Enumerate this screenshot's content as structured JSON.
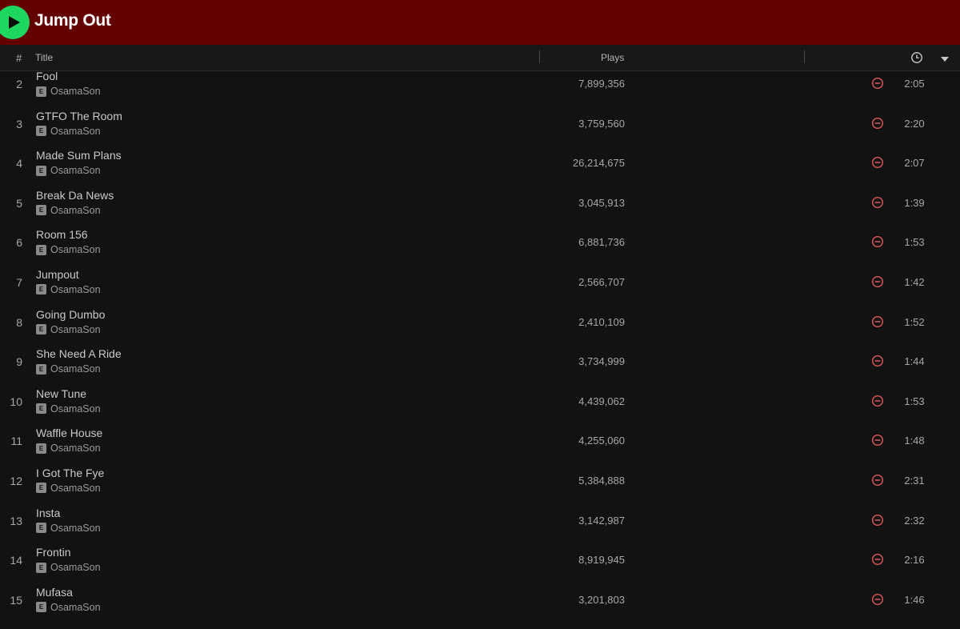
{
  "header": {
    "album_title": "Jump Out"
  },
  "columns": {
    "number": "#",
    "title": "Title",
    "plays": "Plays"
  },
  "icons": {
    "play": "play-icon",
    "clock": "clock-icon",
    "chevron": "chevron-down-icon",
    "remove": "minus-circle-icon",
    "explicit": "explicit-badge"
  },
  "colors": {
    "header_bg": "#630000",
    "play_green": "#1ed760",
    "remove_red": "#e05a5a",
    "background": "#121212"
  },
  "explicit_label": "E",
  "tracks": [
    {
      "num": "2",
      "title": "Fool",
      "artist": "OsamaSon",
      "plays": "7,899,356",
      "duration": "2:05"
    },
    {
      "num": "3",
      "title": "GTFO The Room",
      "artist": "OsamaSon",
      "plays": "3,759,560",
      "duration": "2:20"
    },
    {
      "num": "4",
      "title": "Made Sum Plans",
      "artist": "OsamaSon",
      "plays": "26,214,675",
      "duration": "2:07"
    },
    {
      "num": "5",
      "title": "Break Da News",
      "artist": "OsamaSon",
      "plays": "3,045,913",
      "duration": "1:39"
    },
    {
      "num": "6",
      "title": "Room 156",
      "artist": "OsamaSon",
      "plays": "6,881,736",
      "duration": "1:53"
    },
    {
      "num": "7",
      "title": "Jumpout",
      "artist": "OsamaSon",
      "plays": "2,566,707",
      "duration": "1:42"
    },
    {
      "num": "8",
      "title": "Going Dumbo",
      "artist": "OsamaSon",
      "plays": "2,410,109",
      "duration": "1:52"
    },
    {
      "num": "9",
      "title": "She Need A Ride",
      "artist": "OsamaSon",
      "plays": "3,734,999",
      "duration": "1:44"
    },
    {
      "num": "10",
      "title": "New Tune",
      "artist": "OsamaSon",
      "plays": "4,439,062",
      "duration": "1:53"
    },
    {
      "num": "11",
      "title": "Waffle House",
      "artist": "OsamaSon",
      "plays": "4,255,060",
      "duration": "1:48"
    },
    {
      "num": "12",
      "title": "I Got The Fye",
      "artist": "OsamaSon",
      "plays": "5,384,888",
      "duration": "2:31"
    },
    {
      "num": "13",
      "title": "Insta",
      "artist": "OsamaSon",
      "plays": "3,142,987",
      "duration": "2:32"
    },
    {
      "num": "14",
      "title": "Frontin",
      "artist": "OsamaSon",
      "plays": "8,919,945",
      "duration": "2:16"
    },
    {
      "num": "15",
      "title": "Mufasa",
      "artist": "OsamaSon",
      "plays": "3,201,803",
      "duration": "1:46"
    }
  ]
}
